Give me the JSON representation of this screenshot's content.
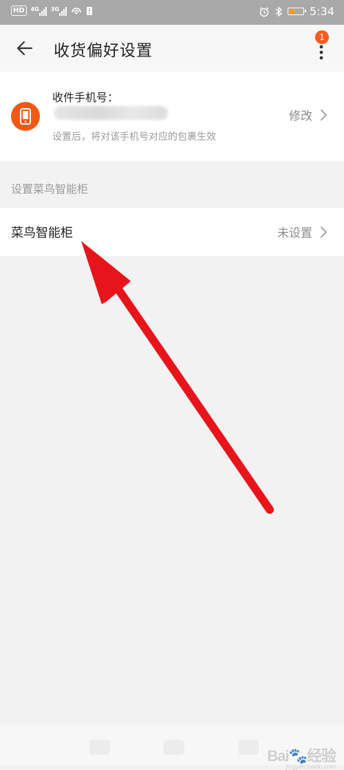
{
  "status_bar": {
    "network_1": "4G",
    "network_2": "3G",
    "time": "5:34",
    "hd_label": "HD"
  },
  "nav": {
    "title": "收货偏好设置",
    "notification_count": "1"
  },
  "phone_card": {
    "label": "收件手机号：",
    "hint": "设置后，将对该手机号对应的包裹生效",
    "edit_label": "修改"
  },
  "section": {
    "title": "设置菜鸟智能柜"
  },
  "locker": {
    "name": "菜鸟智能柜",
    "status": "未设置"
  },
  "watermark": {
    "brand": "Bai",
    "brand_suffix": "经验",
    "url": "jingyan.baidu.com"
  },
  "colors": {
    "accent": "#f05a14",
    "annotation": "#e8141c"
  },
  "icons": [
    "back-arrow-icon",
    "more-vertical-icon",
    "phone-icon",
    "chevron-right-icon",
    "alarm-icon",
    "bluetooth-icon",
    "battery-icon"
  ]
}
